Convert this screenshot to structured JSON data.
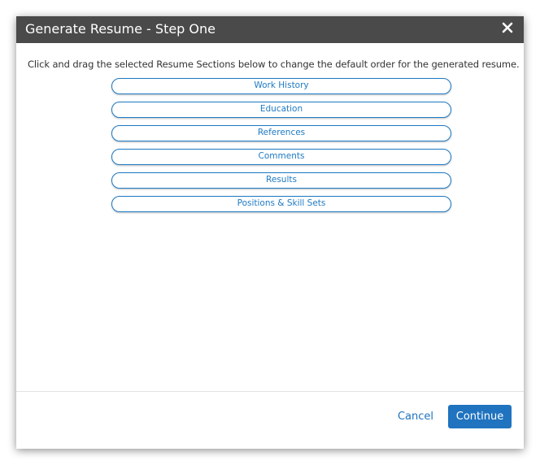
{
  "dialog": {
    "title": "Generate Resume - Step One",
    "close_icon": "close-icon",
    "instructions": "Click and drag the selected Resume Sections below to change the default order for the generated resume."
  },
  "sections": [
    {
      "label": "Work History"
    },
    {
      "label": "Education"
    },
    {
      "label": "References"
    },
    {
      "label": "Comments"
    },
    {
      "label": "Results"
    },
    {
      "label": "Positions & Skill Sets"
    }
  ],
  "footer": {
    "cancel_label": "Cancel",
    "continue_label": "Continue"
  },
  "colors": {
    "header_bg": "#4a4a4a",
    "accent": "#1f73bf"
  }
}
